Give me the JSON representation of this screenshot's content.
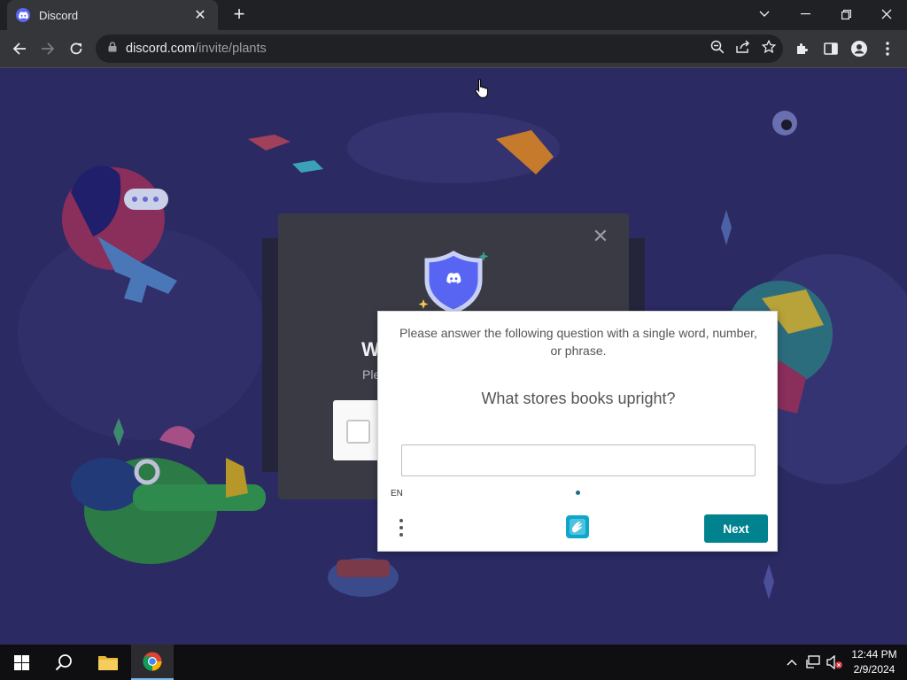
{
  "browser": {
    "tab": {
      "title": "Discord",
      "favicon": "discord-icon"
    },
    "address": {
      "host": "discord.com",
      "path": "/invite/plants"
    }
  },
  "background_modal": {
    "welcome_fragment": "W",
    "please_fragment": "Ple"
  },
  "captcha": {
    "instruction": "Please answer the following question with a single word, number, or phrase.",
    "question": "What stores books upright?",
    "answer_value": "",
    "language": "EN",
    "next_label": "Next"
  },
  "taskbar": {
    "time": "12:44 PM",
    "date": "2/9/2024"
  },
  "colors": {
    "page_bg": "#2b2a63",
    "next_button": "#00838f",
    "discord_blurple": "#5865f2"
  }
}
